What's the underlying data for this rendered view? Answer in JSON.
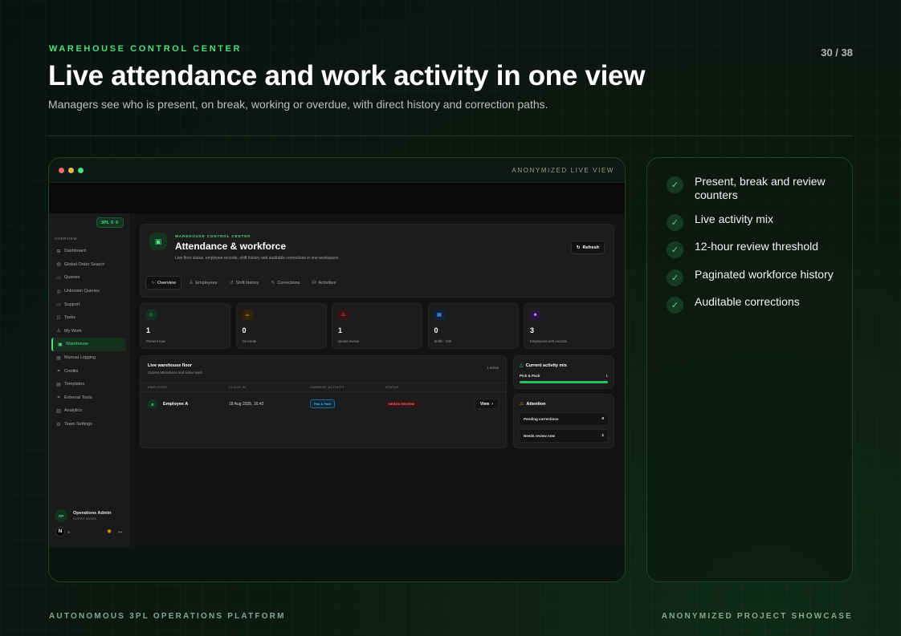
{
  "slide": {
    "kicker": "WAREHOUSE CONTROL CENTER",
    "counter": "30 / 38",
    "title": "Live attendance and work activity in one view",
    "subtitle": "Managers see who is present, on break, working or overdue, with direct history and correction paths.",
    "footer_left": "AUTONOMOUS 3PL OPERATIONS PLATFORM",
    "footer_right": "ANONYMIZED PROJECT SHOWCASE"
  },
  "window": {
    "label": "ANONYMIZED LIVE VIEW",
    "dot_colors": [
      "#ef6b6b",
      "#e8b64c",
      "#4ade80"
    ]
  },
  "colors": {
    "accent": "#4ade80",
    "warning": "#f59e0b",
    "danger": "#f87171",
    "info": "#38bdf8",
    "purple": "#a855f7"
  },
  "app": {
    "brand_badge": "3PL",
    "brand_badge_suffix": "0",
    "nav_section": "OVERVIEW",
    "nav": [
      {
        "label": "Dashboard",
        "icon": "grid-icon",
        "glyph": "⊞"
      },
      {
        "label": "Global Order Search",
        "icon": "globe-icon",
        "glyph": "◍"
      },
      {
        "label": "Queries",
        "icon": "chat-icon",
        "glyph": "▭"
      },
      {
        "label": "Unknown Queries",
        "icon": "help-icon",
        "glyph": "◎"
      },
      {
        "label": "Support",
        "icon": "support-icon",
        "glyph": "▭"
      },
      {
        "label": "Tasks",
        "icon": "tasks-icon",
        "glyph": "☷"
      },
      {
        "label": "My Work",
        "icon": "user-icon",
        "glyph": "♙"
      },
      {
        "label": "Warehouse",
        "icon": "warehouse-icon",
        "glyph": "▣",
        "active": true
      },
      {
        "label": "Manual Logging",
        "icon": "log-icon",
        "glyph": "▤"
      },
      {
        "label": "Credits",
        "icon": "link-icon",
        "glyph": "⚭"
      },
      {
        "label": "Templates",
        "icon": "template-icon",
        "glyph": "▤"
      },
      {
        "label": "External Tools",
        "icon": "external-icon",
        "glyph": "⚭"
      },
      {
        "label": "Analytics",
        "icon": "analytics-icon",
        "glyph": "▥"
      },
      {
        "label": "Team Settings",
        "icon": "gear-icon",
        "glyph": "⚙"
      }
    ],
    "user": {
      "initials": "OP",
      "name": "Operations Admin",
      "role": "SUPER ADMIN",
      "logo_letter": "N",
      "logo_mark": "/li"
    },
    "header": {
      "kicker": "WAREHOUSE CONTROL CENTER",
      "title": "Attendance & workforce",
      "description": "Live floor status, employee records, shift history and auditable corrections in one workspace.",
      "refresh_label": "Refresh"
    },
    "tabs": [
      {
        "label": "Overview",
        "icon": "pulse-icon",
        "glyph": "∿",
        "active": true
      },
      {
        "label": "Employees",
        "icon": "users-icon",
        "glyph": "♙"
      },
      {
        "label": "Shift history",
        "icon": "history-icon",
        "glyph": "↺"
      },
      {
        "label": "Corrections",
        "icon": "edit-icon",
        "glyph": "✎"
      },
      {
        "label": "Activities",
        "icon": "activities-icon",
        "glyph": "⛁"
      }
    ],
    "stats": [
      {
        "value": "1",
        "label": "Present now",
        "icon": "user-check-icon",
        "glyph": "☺",
        "color": "#4ade80",
        "bg": "#143322"
      },
      {
        "value": "0",
        "label": "On break",
        "icon": "coffee-icon",
        "glyph": "☕",
        "color": "#f59e0b",
        "bg": "#33230a"
      },
      {
        "value": "1",
        "label": "Needs review",
        "icon": "alert-icon",
        "glyph": "⚠",
        "color": "#f87171",
        "bg": "#3a1414"
      },
      {
        "value": "0",
        "label": "Shifts · 24h",
        "icon": "calendar-icon",
        "glyph": "▦",
        "color": "#60a5fa",
        "bg": "#102340"
      },
      {
        "value": "3",
        "label": "Employees with records",
        "icon": "team-icon",
        "glyph": "☻",
        "color": "#c084fc",
        "bg": "#2a1640"
      }
    ],
    "floor": {
      "title": "Live warehouse floor",
      "subtitle": "Current attendance and active work.",
      "count": "1 active",
      "columns": [
        "EMPLOYEE",
        "CLOCK IN",
        "CURRENT ACTIVITY",
        "STATUS"
      ],
      "rows": [
        {
          "initial": "E",
          "name": "Employee A",
          "clock_in": "18 Aug 2026, 16:42",
          "activity": "Pick & Pack",
          "status": "NEEDS REVIEW",
          "action": "View"
        }
      ]
    },
    "activity_mix": {
      "title": "Current activity mix",
      "items": [
        {
          "name": "Pick & Pack",
          "count": "1",
          "share": 1.0
        }
      ]
    },
    "attention": {
      "title": "Attention",
      "items": [
        {
          "label": "Pending corrections",
          "value": "0"
        },
        {
          "label": "Needs review now",
          "value": "1"
        }
      ]
    }
  },
  "features": [
    "Present, break and review counters",
    "Live activity mix",
    "12-hour review threshold",
    "Paginated workforce history",
    "Auditable corrections"
  ]
}
